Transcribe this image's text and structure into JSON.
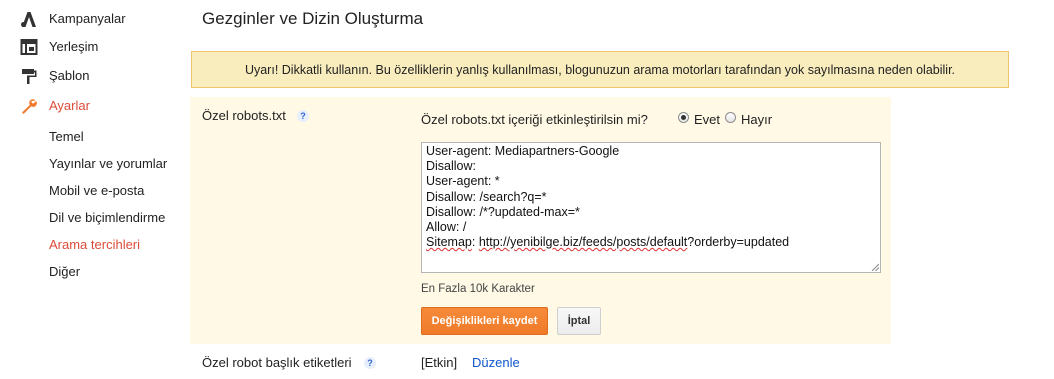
{
  "sidebar": {
    "items": [
      {
        "label": "Kampanyalar",
        "icon": "adwords-icon"
      },
      {
        "label": "Yerleşim",
        "icon": "layout-icon"
      },
      {
        "label": "Şablon",
        "icon": "paint-roller-icon"
      },
      {
        "label": "Ayarlar",
        "icon": "wrench-icon",
        "active": true
      }
    ],
    "sub_items": [
      {
        "label": "Temel"
      },
      {
        "label": "Yayınlar ve yorumlar"
      },
      {
        "label": "Mobil ve e-posta"
      },
      {
        "label": "Dil ve biçimlendirme"
      },
      {
        "label": "Arama tercihleri",
        "active": true
      },
      {
        "label": "Diğer"
      }
    ]
  },
  "main": {
    "title": "Gezginler ve Dizin Oluşturma",
    "warning": "Uyarı! Dikkatli kullanın. Bu özelliklerin yanlış kullanılması, blogunuzun arama motorları tarafından yok sayılmasına neden olabilir.",
    "robots": {
      "label": "Özel robots.txt",
      "help": "?",
      "question": "Özel robots.txt içeriği etkinleştirilsin mi?",
      "option_yes": "Evet",
      "option_no": "Hayır",
      "selected": "Evet",
      "content_lines": [
        "User-agent: Mediapartners-Google",
        "Disallow:",
        "User-agent: *",
        "Disallow: /search?q=*",
        "Disallow: /*?updated-max=*",
        "Allow: /"
      ],
      "sitemap_key": "Sitemap",
      "sitemap_sep": ": ",
      "sitemap_url": "http://yenibilge.biz/feeds/posts/default",
      "sitemap_query": "?orderby=updated",
      "hint": "En Fazla 10k Karakter",
      "save_label": "Değişiklikleri kaydet",
      "cancel_label": "İptal"
    },
    "header_tags": {
      "label": "Özel robot başlık etiketleri",
      "help": "?",
      "status": "[Etkin]",
      "edit_label": "Düzenle"
    }
  },
  "colors": {
    "accent": "#dd4b39",
    "link": "#1155cc",
    "warning_bg": "#f9edbe",
    "warning_border": "#f0c36d",
    "panel_bg": "#fff9e6",
    "save_button": "#f17f2f"
  }
}
